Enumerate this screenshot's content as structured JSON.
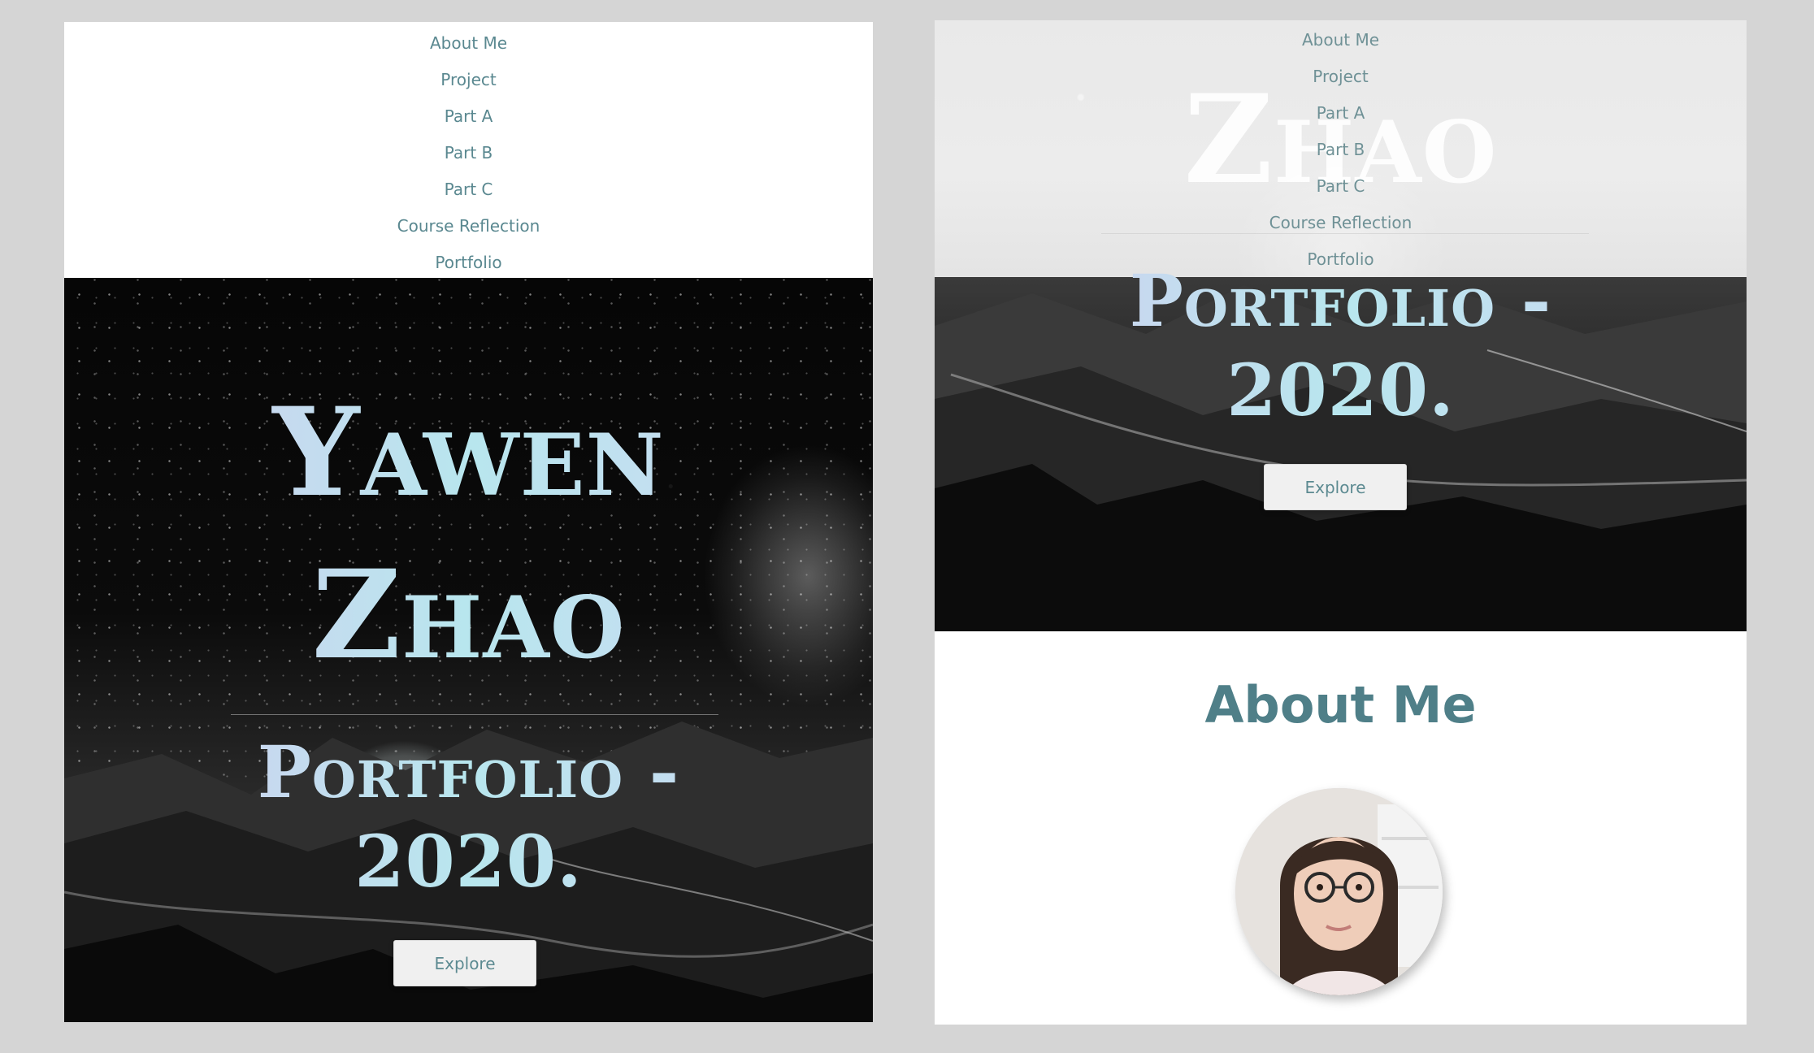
{
  "nav": {
    "items": [
      "About Me",
      "Project",
      "Part A",
      "Part B",
      "Part C",
      "Course Reflection",
      "Portfolio"
    ]
  },
  "hero": {
    "name_line1": "Yawen",
    "name_line2": "Zhao",
    "subtitle_line1": "Portfolio -",
    "subtitle_line2": "2020.",
    "explore_label": "Explore"
  },
  "about": {
    "heading": "About Me"
  },
  "colors": {
    "nav_text": "#5a8890",
    "heading_teal": "#4f7f88",
    "button_bg": "#f0f0f0",
    "page_bg": "#d5d5d5"
  }
}
